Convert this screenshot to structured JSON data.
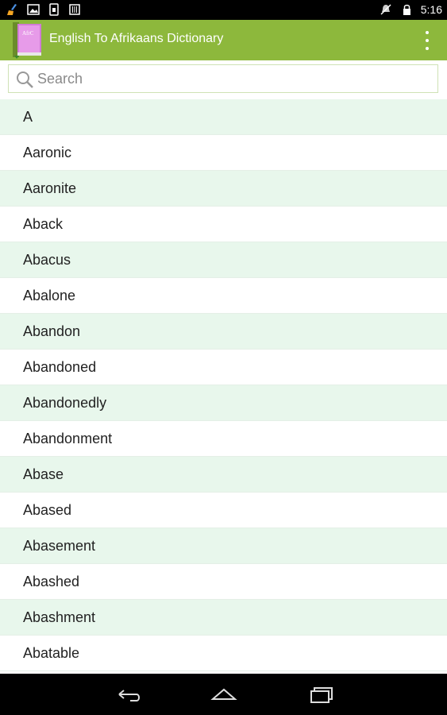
{
  "status_bar": {
    "time": "5:16",
    "left_icons": [
      "broom-icon",
      "image-icon",
      "sim-card-icon",
      "barcode-icon"
    ],
    "right_icons": [
      "no-notification-icon",
      "lock-battery-icon"
    ]
  },
  "action_bar": {
    "title": "English To Afrikaans Dictionary",
    "logo_text": "AfrC",
    "color": "#8DB83C"
  },
  "search": {
    "placeholder": "Search",
    "value": ""
  },
  "words": [
    "A",
    "Aaronic",
    "Aaronite",
    "Aback",
    "Abacus",
    "Abalone",
    "Abandon",
    "Abandoned",
    "Abandonedly",
    "Abandonment",
    "Abase",
    "Abased",
    "Abasement",
    "Abashed",
    "Abashment",
    "Abatable"
  ],
  "colors": {
    "row_alt": "#E8F7EC",
    "row": "#FFFFFF"
  },
  "nav_bar": {
    "buttons": [
      "back-icon",
      "home-icon",
      "recents-icon"
    ]
  }
}
